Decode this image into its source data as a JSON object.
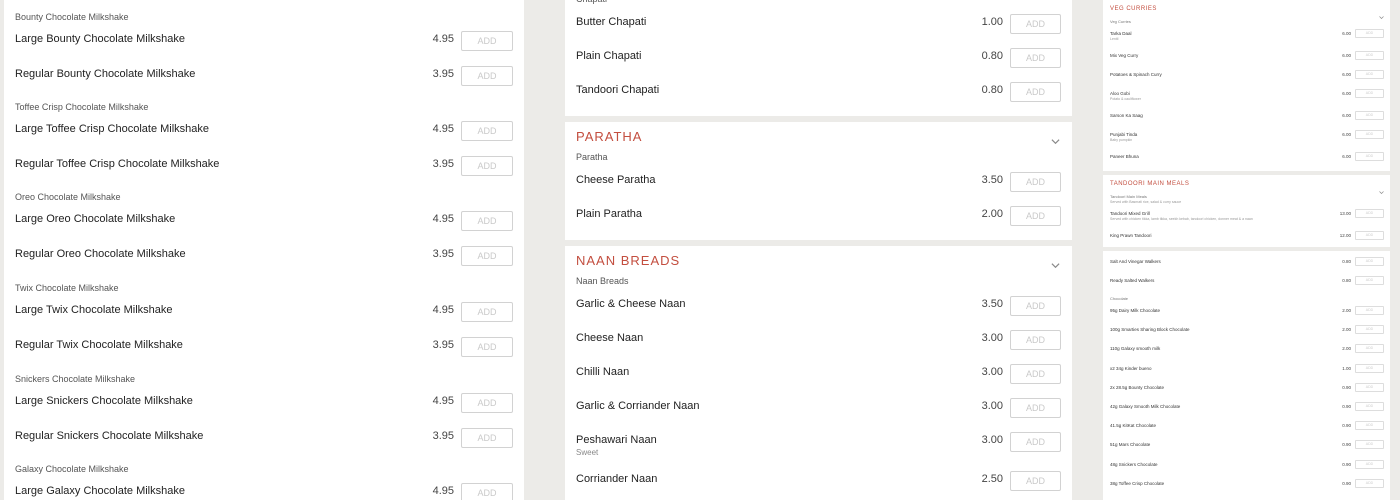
{
  "left_column": {
    "groups": [
      {
        "header": "Bounty Chocolate Milkshake",
        "items": [
          {
            "name": "Large Bounty Chocolate Milkshake",
            "price": "4.95",
            "add": "ADD"
          },
          {
            "name": "Regular Bounty Chocolate Milkshake",
            "price": "3.95",
            "add": "ADD"
          }
        ]
      },
      {
        "header": "Toffee Crisp Chocolate Milkshake",
        "items": [
          {
            "name": "Large Toffee Crisp Chocolate Milkshake",
            "price": "4.95",
            "add": "ADD"
          },
          {
            "name": "Regular Toffee Crisp Chocolate Milkshake",
            "price": "3.95",
            "add": "ADD"
          }
        ]
      },
      {
        "header": "Oreo Chocolate Milkshake",
        "items": [
          {
            "name": "Large Oreo Chocolate Milkshake",
            "price": "4.95",
            "add": "ADD"
          },
          {
            "name": "Regular Oreo Chocolate Milkshake",
            "price": "3.95",
            "add": "ADD"
          }
        ]
      },
      {
        "header": "Twix Chocolate Milkshake",
        "items": [
          {
            "name": "Large Twix Chocolate Milkshake",
            "price": "4.95",
            "add": "ADD"
          },
          {
            "name": "Regular Twix Chocolate Milkshake",
            "price": "3.95",
            "add": "ADD"
          }
        ]
      },
      {
        "header": "Snickers Chocolate Milkshake",
        "items": [
          {
            "name": "Large Snickers Chocolate Milkshake",
            "price": "4.95",
            "add": "ADD"
          },
          {
            "name": "Regular Snickers Chocolate Milkshake",
            "price": "3.95",
            "add": "ADD"
          }
        ]
      },
      {
        "header": "Galaxy Chocolate Milkshake",
        "items": [
          {
            "name": "Large Galaxy Chocolate Milkshake",
            "price": "4.95",
            "add": "ADD"
          }
        ]
      }
    ]
  },
  "middle_column": {
    "chapati": {
      "header": "Chapati",
      "items": [
        {
          "name": "Butter Chapati",
          "price": "1.00",
          "add": "ADD"
        },
        {
          "name": "Plain Chapati",
          "price": "0.80",
          "add": "ADD"
        },
        {
          "name": "Tandoori Chapati",
          "price": "0.80",
          "add": "ADD"
        }
      ]
    },
    "paratha": {
      "title": "PARATHA",
      "header": "Paratha",
      "items": [
        {
          "name": "Cheese Paratha",
          "price": "3.50",
          "add": "ADD"
        },
        {
          "name": "Plain Paratha",
          "price": "2.00",
          "add": "ADD"
        }
      ]
    },
    "naan": {
      "title": "NAAN BREADS",
      "header": "Naan Breads",
      "items": [
        {
          "name": "Garlic & Cheese Naan",
          "price": "3.50",
          "add": "ADD",
          "sub": ""
        },
        {
          "name": "Cheese Naan",
          "price": "3.00",
          "add": "ADD",
          "sub": ""
        },
        {
          "name": "Chilli Naan",
          "price": "3.00",
          "add": "ADD",
          "sub": ""
        },
        {
          "name": "Garlic & Corriander Naan",
          "price": "3.00",
          "add": "ADD",
          "sub": ""
        },
        {
          "name": "Peshawari Naan",
          "price": "3.00",
          "add": "ADD",
          "sub": "Sweet"
        },
        {
          "name": "Corriander Naan",
          "price": "2.50",
          "add": "ADD",
          "sub": ""
        }
      ]
    }
  },
  "right_column": {
    "veg": {
      "title": "VEG CURRIES",
      "header": "Veg Curries",
      "items": [
        {
          "name": "Tarka Daal",
          "sub": "Lentil",
          "price": "6.00",
          "add": "ADD"
        },
        {
          "name": "Mix Veg Curry",
          "sub": "",
          "price": "6.00",
          "add": "ADD"
        },
        {
          "name": "Potatoes & Spinach Curry",
          "sub": "",
          "price": "6.00",
          "add": "ADD"
        },
        {
          "name": "Aloo Gobi",
          "sub": "Potato & cauliflower",
          "price": "6.00",
          "add": "ADD"
        },
        {
          "name": "Sarson Ka Saag",
          "sub": "",
          "price": "6.00",
          "add": "ADD"
        },
        {
          "name": "Punjabi Tinda",
          "sub": "Baby pumpkin",
          "price": "6.00",
          "add": "ADD"
        },
        {
          "name": "Paneer Bhuna",
          "sub": "",
          "price": "6.00",
          "add": "ADD"
        }
      ]
    },
    "tandoori": {
      "title": "TANDOORI MAIN MEALS",
      "header": "Tandoori Main Meals",
      "header_sub": "Served with Basmati rice, salad & curry sauce",
      "items": [
        {
          "name": "Tandoori Mixed Grill",
          "sub": "Served with chicken tikka, lamb tikka, seekh kebab, tandoori chicken, donner meat & a naan",
          "price": "13.00",
          "add": "ADD"
        },
        {
          "name": "King Prawn Tandoori",
          "sub": "",
          "price": "12.00",
          "add": "ADD"
        }
      ]
    },
    "snacks": {
      "items": [
        {
          "name": "Salt And Vinegar Walkers",
          "price": "0.80",
          "add": "ADD"
        },
        {
          "name": "Ready Salted Walkers",
          "price": "0.80",
          "add": "ADD"
        }
      ],
      "chocolate_header": "Chocolate",
      "chocolate_items": [
        {
          "name": "95g Dairy Milk Chocolate",
          "price": "2.00",
          "add": "ADD"
        },
        {
          "name": "100g Smarties Sharing Block Chocolate",
          "price": "2.00",
          "add": "ADD"
        },
        {
          "name": "110g Galaxy smooth milk",
          "price": "2.00",
          "add": "ADD"
        },
        {
          "name": "x2 34g Kinder bueno",
          "price": "1.00",
          "add": "ADD"
        },
        {
          "name": "2x 28.5g Bounty Chocolate",
          "price": "0.90",
          "add": "ADD"
        },
        {
          "name": "42g Galaxy Smooth Milk Chocolate",
          "price": "0.90",
          "add": "ADD"
        },
        {
          "name": "41.5g KitKat Chocolate",
          "price": "0.90",
          "add": "ADD"
        },
        {
          "name": "51g Mars Chocolate",
          "price": "0.90",
          "add": "ADD"
        },
        {
          "name": "48g Snickers Chocolate",
          "price": "0.90",
          "add": "ADD"
        },
        {
          "name": "38g Toffee Crisp Chocolate",
          "price": "0.90",
          "add": "ADD"
        }
      ]
    }
  },
  "colors": {
    "accent": "#c34e3f",
    "background": "#ecebe8"
  }
}
